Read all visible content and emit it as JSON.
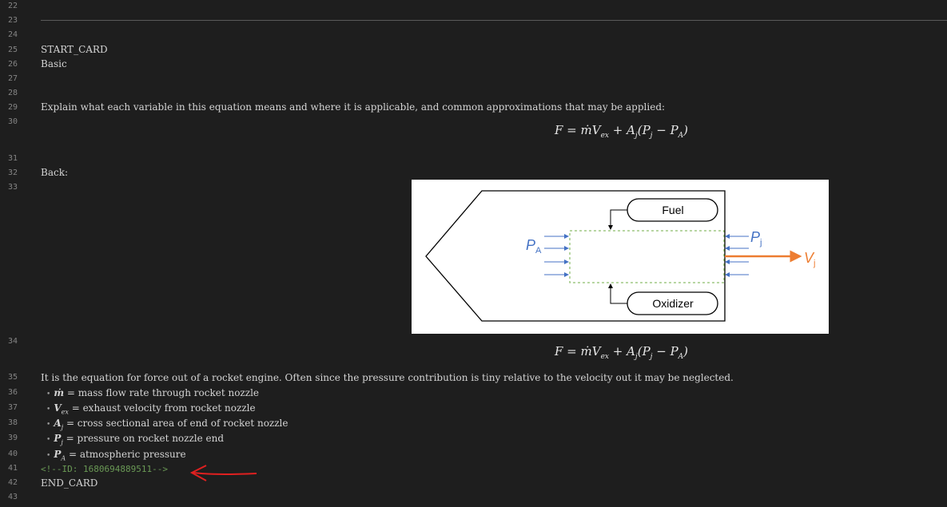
{
  "line_numbers": [
    "22",
    "23",
    "24",
    "25",
    "26",
    "27",
    "28",
    "29",
    "30",
    "31",
    "32",
    "33",
    "34",
    "35",
    "36",
    "37",
    "38",
    "39",
    "40",
    "41",
    "42",
    "43"
  ],
  "lines": {
    "start_card": "START_CARD",
    "deck": "Basic",
    "prompt": "Explain what each variable in this equation means and where it is applicable, and common approximations that may be applied:",
    "back": "Back:",
    "explanation": "It is the equation for force out of a rocket engine. Often since the pressure contribution is tiny relative to the velocity out it may be neglected.",
    "comment": "<!--ID: 1680694889511-->",
    "end_card": "END_CARD"
  },
  "bullets": [
    {
      "var": "ṁ",
      "sub": "",
      "desc": "= mass flow rate through rocket nozzle"
    },
    {
      "var": "V",
      "sub": "ex",
      "desc": "= exhaust velocity from rocket nozzle"
    },
    {
      "var": "A",
      "sub": "j",
      "desc": "= cross sectional area of end of rocket nozzle"
    },
    {
      "var": "P",
      "sub": "j",
      "desc": "= pressure on rocket nozzle end"
    },
    {
      "var": "P",
      "sub": "A",
      "desc": "= atmospheric pressure"
    }
  ],
  "diagram": {
    "fuel": "Fuel",
    "oxidizer": "Oxidizer",
    "pa_main": "P",
    "pa_sub": "A",
    "pj_main": "P",
    "pj_sub": "j",
    "vj_main": "V",
    "vj_sub": "j"
  },
  "colors": {
    "background": "#1e1e1e",
    "line_number": "#858585",
    "comment": "#6a9955",
    "annotation": "#e02020",
    "pressure_arrow": "#4472c4",
    "velocity_arrow": "#ed7d31",
    "control_volume": "#70ad47"
  }
}
